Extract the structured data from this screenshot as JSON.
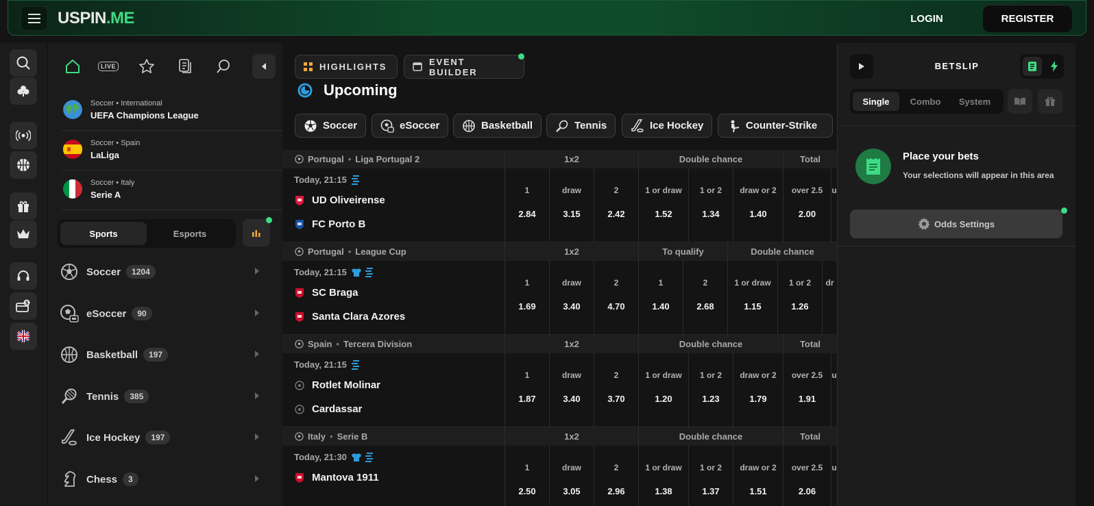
{
  "header": {
    "logo_main": "USPIN",
    "logo_dot": ".ME",
    "login": "LOGIN",
    "register": "REGISTER"
  },
  "sidebar": {
    "top_leagues": [
      {
        "sport": "Soccer",
        "region": "International",
        "name": "UEFA Champions League",
        "flag": "globe"
      },
      {
        "sport": "Soccer",
        "region": "Spain",
        "name": "LaLiga",
        "flag": "spain"
      },
      {
        "sport": "Soccer",
        "region": "Italy",
        "name": "Serie A",
        "flag": "italy"
      }
    ],
    "live_badge": "LIVE",
    "segment": {
      "sports": "Sports",
      "esports": "Esports",
      "active": "Sports"
    },
    "sports": [
      {
        "name": "Soccer",
        "count": "1204",
        "icon": "soccer-ball-icon"
      },
      {
        "name": "eSoccer",
        "count": "90",
        "icon": "esoccer-icon"
      },
      {
        "name": "Basketball",
        "count": "197",
        "icon": "basketball-icon"
      },
      {
        "name": "Tennis",
        "count": "385",
        "icon": "tennis-icon"
      },
      {
        "name": "Ice Hockey",
        "count": "197",
        "icon": "hockey-icon"
      },
      {
        "name": "Chess",
        "count": "3",
        "icon": "chess-knight-icon"
      }
    ]
  },
  "main": {
    "tabs": {
      "highlights": "HIGHLIGHTS",
      "event_builder": "EVENT BUILDER"
    },
    "section_title": "Upcoming",
    "sport_chips": [
      "Soccer",
      "eSoccer",
      "Basketball",
      "Tennis",
      "Ice Hockey",
      "Counter-Strike"
    ],
    "events": [
      {
        "country": "Portugal",
        "league": "Liga Portugal 2",
        "time": "Today, 21:15",
        "home": "UD Oliveirense",
        "away": "FC Porto B",
        "groups": [
          "1x2",
          "Double chance",
          "Total"
        ],
        "labels": [
          "1",
          "draw",
          "2",
          "1 or draw",
          "1 or 2",
          "draw or 2",
          "over 2.5",
          "u"
        ],
        "odds": [
          "2.84",
          "3.15",
          "2.42",
          "1.52",
          "1.34",
          "1.40",
          "2.00",
          ""
        ]
      },
      {
        "country": "Portugal",
        "league": "League Cup",
        "time": "Today, 21:15",
        "home": "SC Braga",
        "away": "Santa Clara Azores",
        "groups": [
          "1x2",
          "To qualify",
          "Double chance"
        ],
        "labels": [
          "1",
          "draw",
          "2",
          "1",
          "2",
          "1 or draw",
          "1 or 2",
          "dr"
        ],
        "odds": [
          "1.69",
          "3.40",
          "4.70",
          "1.40",
          "2.68",
          "1.15",
          "1.26",
          ""
        ]
      },
      {
        "country": "Spain",
        "league": "Tercera Division",
        "time": "Today, 21:15",
        "home": "Rotlet Molinar",
        "away": "Cardassar",
        "groups": [
          "1x2",
          "Double chance",
          "Total"
        ],
        "labels": [
          "1",
          "draw",
          "2",
          "1 or draw",
          "1 or 2",
          "draw or 2",
          "over 2.5",
          "u"
        ],
        "odds": [
          "1.87",
          "3.40",
          "3.70",
          "1.20",
          "1.23",
          "1.79",
          "1.91",
          ""
        ]
      },
      {
        "country": "Italy",
        "league": "Serie B",
        "time": "Today, 21:30",
        "home": "Mantova 1911",
        "away": "",
        "groups": [
          "1x2",
          "Double chance",
          "Total"
        ],
        "labels": [
          "1",
          "draw",
          "2",
          "1 or draw",
          "1 or 2",
          "draw or 2",
          "over 2.5",
          "u"
        ],
        "odds": [
          "2.50",
          "3.05",
          "2.96",
          "1.38",
          "1.37",
          "1.51",
          "2.06",
          ""
        ]
      }
    ]
  },
  "betslip": {
    "title": "BETSLIP",
    "tabs": [
      "Single",
      "Combo",
      "System"
    ],
    "active_tab": "Single",
    "empty_title": "Place your bets",
    "empty_sub": "Your selections will appear in this area",
    "odds_settings": "Odds Settings"
  },
  "colors": {
    "accent_green": "#3ddc84",
    "background": "#141414",
    "panel": "#1b1b1b",
    "info_blue": "#2d9cdb",
    "highlight_orange": "#f2a93b"
  }
}
